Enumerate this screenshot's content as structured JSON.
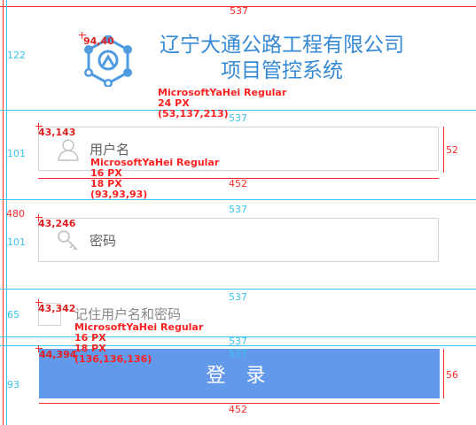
{
  "app": {
    "title_line1": "辽宁大通公路工程有限公司",
    "title_line2": "项目管控系统",
    "logo_icon": "network-user-logo-icon"
  },
  "form": {
    "username_placeholder": "用户名",
    "username_icon": "user-icon",
    "password_placeholder": "密码",
    "password_icon": "key-icon",
    "remember_label": "记住用户名和密码",
    "login_label": "登 录"
  },
  "colors": {
    "title": "#3589d5",
    "placeholder": "#5d5d5d",
    "remember": "#888888",
    "button": "#6399ea",
    "button_text": "#ffffff"
  },
  "annotations": {
    "canvas_width": "537",
    "canvas_height": "480",
    "section_heights": [
      "122",
      "101",
      "101",
      "65",
      "93"
    ],
    "section_width": "537",
    "field_width": "452",
    "field_height": "52",
    "button_height": "56",
    "logo_coord": "94,40",
    "username_coord": "43,143",
    "password_coord": "43,246",
    "checkbox_coord": "43,342",
    "button_coord": "44,394",
    "title_spec": "MicrosoftYaHei Regular\n24 PX\n(53,137,213)",
    "field_spec": "MicrosoftYaHei Regular\n16 PX\n18 PX\n(93,93,93)",
    "remember_spec": "MicrosoftYaHei Regular\n16 PX\n18 PX\n(136,136,136)"
  }
}
